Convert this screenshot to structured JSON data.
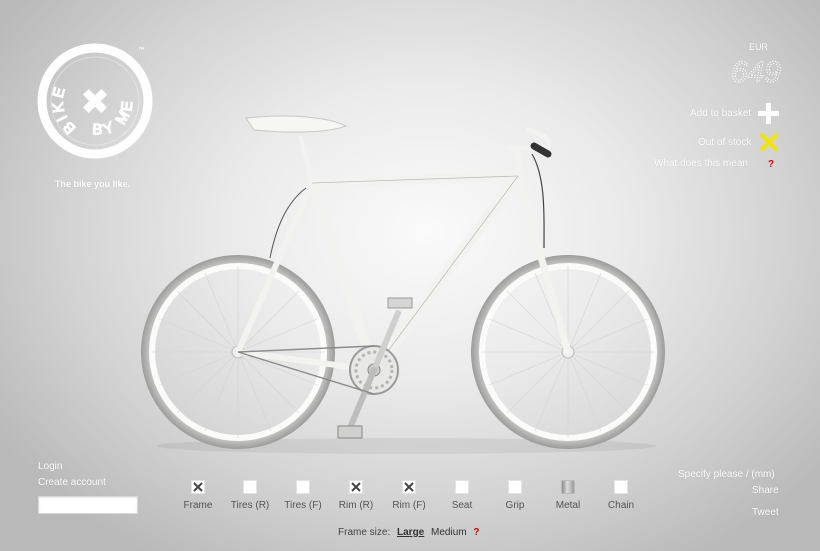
{
  "logo": {
    "word_top": "BIKE",
    "word_bottom": "BY ME",
    "trademark": "™",
    "tagline": "The bike you like."
  },
  "price": {
    "currency": "EUR",
    "amount": "649"
  },
  "actions": {
    "add_to_basket": "Add to basket",
    "out_of_stock": "Out of stock",
    "what_does_this_mean": "What does this mean",
    "help_mark": "?"
  },
  "account": {
    "login": "Login",
    "create_account": "Create account"
  },
  "parts": [
    {
      "label": "Frame",
      "state": "x"
    },
    {
      "label": "Tires (R)",
      "state": "empty"
    },
    {
      "label": "Tires (F)",
      "state": "empty"
    },
    {
      "label": "Rim (R)",
      "state": "x"
    },
    {
      "label": "Rim (F)",
      "state": "x"
    },
    {
      "label": "Seat",
      "state": "empty"
    },
    {
      "label": "Grip",
      "state": "empty"
    },
    {
      "label": "Metal",
      "state": "metal"
    },
    {
      "label": "Chain",
      "state": "empty"
    }
  ],
  "frame_size": {
    "label": "Frame size:",
    "options": [
      "Large",
      "Medium"
    ],
    "selected": "Large",
    "help_mark": "?"
  },
  "right_links": {
    "specify": "Specify please / (mm)",
    "share": "Share",
    "tweet": "Tweet"
  },
  "colors": {
    "accent_yellow": "#f2e600",
    "help_red": "#d60000",
    "bike_white": "#f2f2ef"
  },
  "icons": {
    "add": "plus-icon",
    "out_of_stock": "x-icon"
  }
}
